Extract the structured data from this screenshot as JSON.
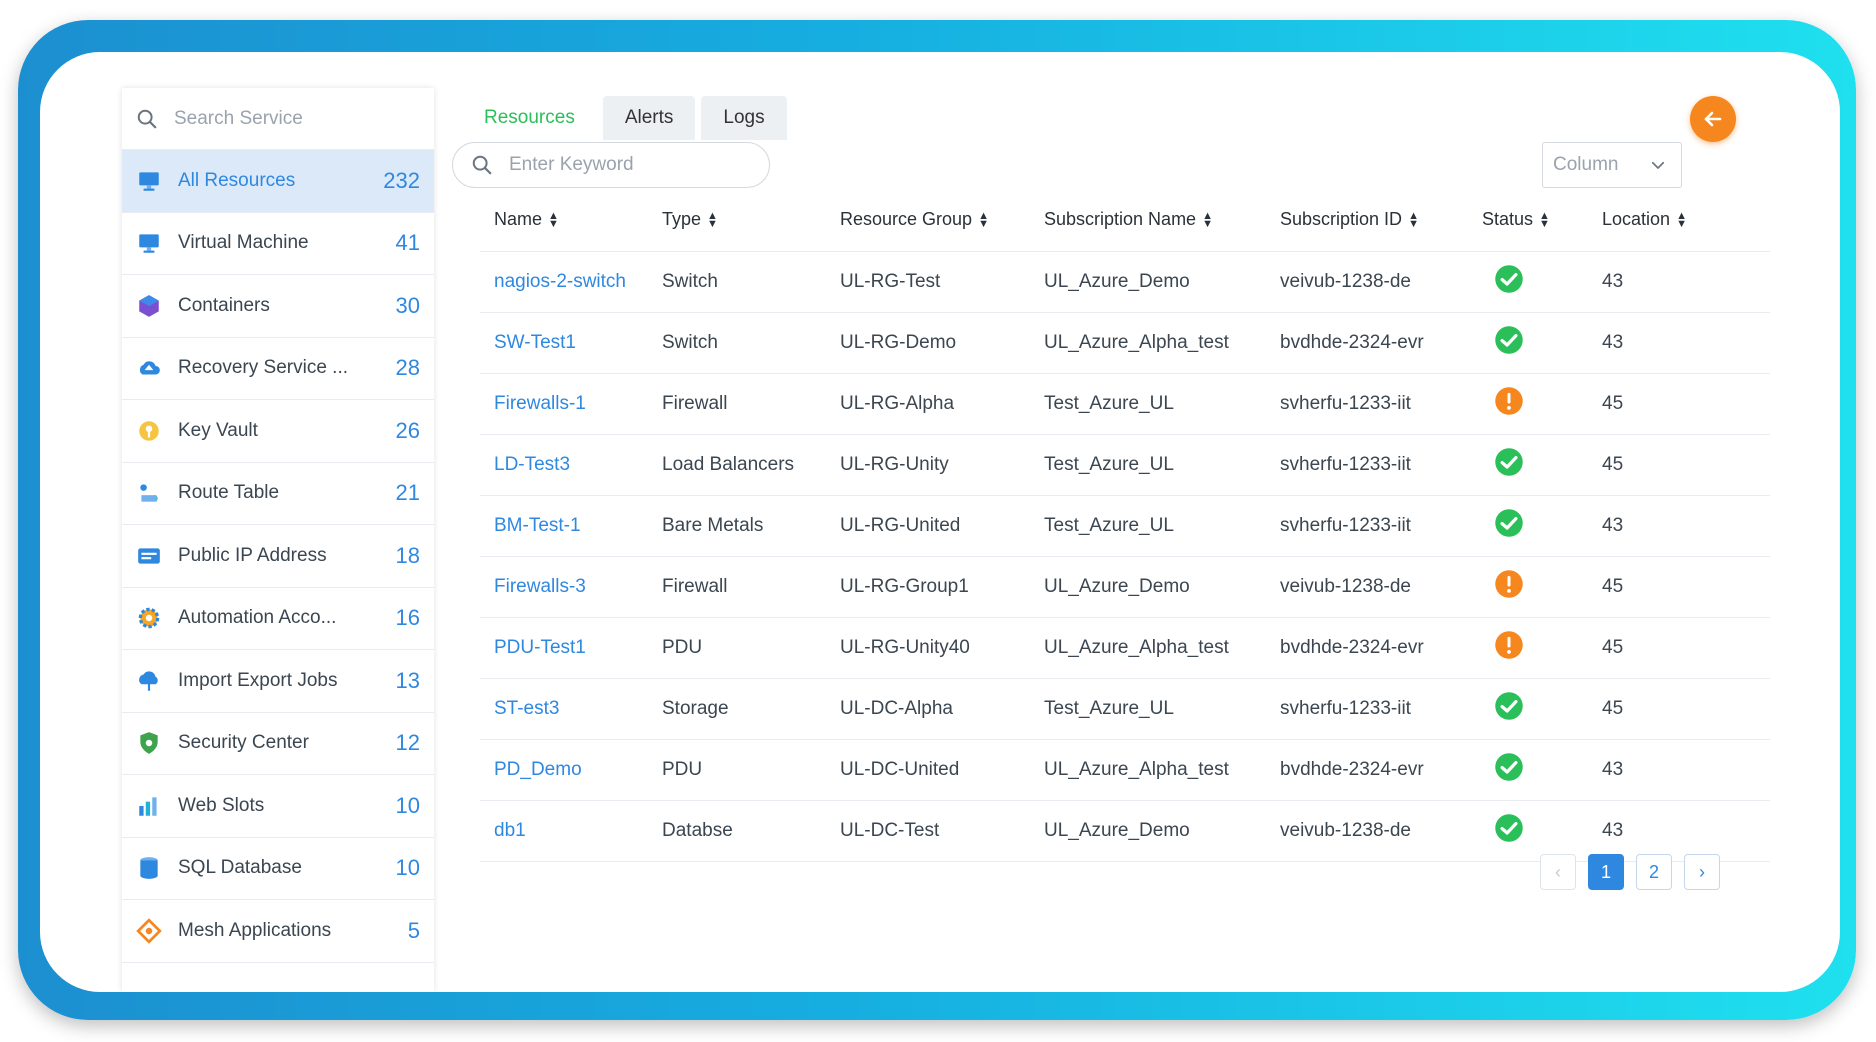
{
  "search": {
    "placeholder": "Search Service"
  },
  "sidebar": {
    "items": [
      {
        "label": "All Resources",
        "count": "232",
        "icon": "monitor-icon",
        "active": true
      },
      {
        "label": "Virtual Machine",
        "count": "41",
        "icon": "monitor-icon"
      },
      {
        "label": "Containers",
        "count": "30",
        "icon": "cube-icon"
      },
      {
        "label": "Recovery Service ...",
        "count": "28",
        "icon": "cloud-upload-icon"
      },
      {
        "label": "Key Vault",
        "count": "26",
        "icon": "key-icon"
      },
      {
        "label": "Route Table",
        "count": "21",
        "icon": "route-icon"
      },
      {
        "label": "Public IP Address",
        "count": "18",
        "icon": "ip-icon"
      },
      {
        "label": "Automation Acco...",
        "count": "16",
        "icon": "gear-icon"
      },
      {
        "label": "Import Export Jobs",
        "count": "13",
        "icon": "cloud-transfer-icon"
      },
      {
        "label": "Security Center",
        "count": "12",
        "icon": "shield-icon"
      },
      {
        "label": "Web Slots",
        "count": "10",
        "icon": "web-slots-icon"
      },
      {
        "label": "SQL Database",
        "count": "10",
        "icon": "database-icon"
      },
      {
        "label": "Mesh Applications",
        "count": "5",
        "icon": "mesh-icon"
      }
    ]
  },
  "tabs": [
    {
      "label": "Resources",
      "active": true
    },
    {
      "label": "Alerts"
    },
    {
      "label": "Logs"
    }
  ],
  "keyword": {
    "placeholder": "Enter Keyword"
  },
  "column_select": {
    "label": "Column"
  },
  "table": {
    "headers": [
      "Name",
      "Type",
      "Resource Group",
      "Subscription Name",
      "Subscription ID",
      "Status",
      "Location"
    ],
    "rows": [
      [
        "nagios-2-switch",
        "Switch",
        "UL-RG-Test",
        "UL_Azure_Demo",
        "veivub-1238-de",
        "ok",
        "43"
      ],
      [
        "SW-Test1",
        "Switch",
        "UL-RG-Demo",
        "UL_Azure_Alpha_test",
        "bvdhde-2324-evr",
        "ok",
        "43"
      ],
      [
        "Firewalls-1",
        "Firewall",
        "UL-RG-Alpha",
        "Test_Azure_UL",
        "svherfu-1233-iit",
        "warning",
        "45"
      ],
      [
        "LD-Test3",
        "Load Balancers",
        "UL-RG-Unity",
        "Test_Azure_UL",
        "svherfu-1233-iit",
        "ok",
        "45"
      ],
      [
        "BM-Test-1",
        "Bare Metals",
        "UL-RG-United",
        "Test_Azure_UL",
        "svherfu-1233-iit",
        "ok",
        "43"
      ],
      [
        "Firewalls-3",
        "Firewall",
        "UL-RG-Group1",
        "UL_Azure_Demo",
        "veivub-1238-de",
        "warning",
        "45"
      ],
      [
        "PDU-Test1",
        "PDU",
        "UL-RG-Unity40",
        "UL_Azure_Alpha_test",
        "bvdhde-2324-evr",
        "warning",
        "45"
      ],
      [
        "ST-est3",
        "Storage",
        "UL-DC-Alpha",
        "Test_Azure_UL",
        "svherfu-1233-iit",
        "ok",
        "45"
      ],
      [
        "PD_Demo",
        "PDU",
        "UL-DC-United",
        "UL_Azure_Alpha_test",
        "bvdhde-2324-evr",
        "ok",
        "43"
      ],
      [
        "db1",
        "Databse",
        "UL-DC-Test",
        "UL_Azure_Demo",
        "veivub-1238-de",
        "ok",
        "43"
      ]
    ]
  },
  "pagination": {
    "prev": "‹",
    "pages": [
      "1",
      "2"
    ],
    "current": "1",
    "next": "›"
  },
  "colors": {
    "accent": "#2f88e0",
    "ok": "#2bbf5a",
    "warning": "#f6871f",
    "tab_active": "#2bbf5a"
  }
}
